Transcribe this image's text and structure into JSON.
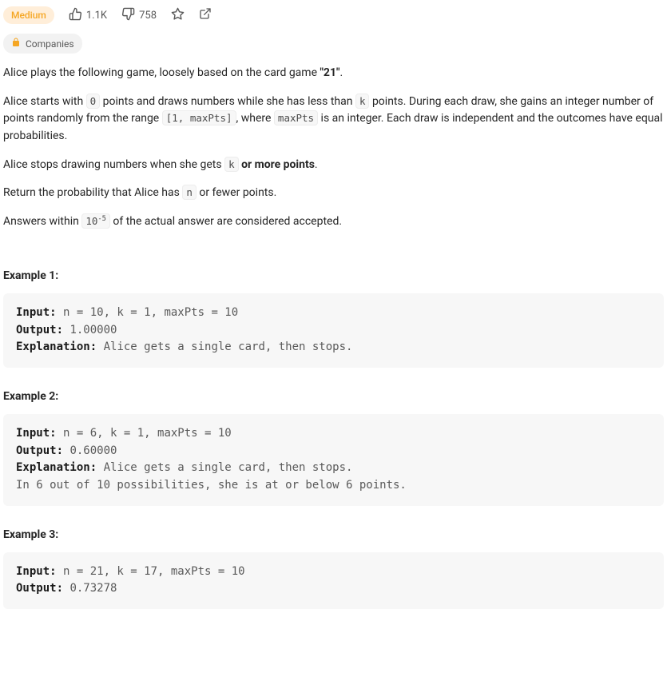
{
  "header": {
    "difficulty": "Medium",
    "likes": "1.1K",
    "dislikes": "758"
  },
  "companies": {
    "label": "Companies"
  },
  "desc": {
    "p1_a": "Alice plays the following game, loosely based on the card game ",
    "p1_b": "\"21\"",
    "p1_c": ".",
    "p2_a": "Alice starts with ",
    "p2_code1": "0",
    "p2_b": " points and draws numbers while she has less than ",
    "p2_code2": "k",
    "p2_c": " points. During each draw, she gains an integer number of points randomly from the range ",
    "p2_code3": "[1, maxPts]",
    "p2_d": ", where ",
    "p2_code4": "maxPts",
    "p2_e": " is an integer. Each draw is independent and the outcomes have equal probabilities.",
    "p3_a": "Alice stops drawing numbers when she gets ",
    "p3_code1": "k",
    "p3_b": " or more points",
    "p3_c": ".",
    "p4_a": "Return the probability that Alice has ",
    "p4_code1": "n",
    "p4_b": " or fewer points.",
    "p5_a": "Answers within ",
    "p5_code_base": "10",
    "p5_code_sup": "-5",
    "p5_b": " of the actual answer are considered accepted."
  },
  "examples": [
    {
      "heading": "Example 1:",
      "kw_input": "Input:",
      "input": " n = 10, k = 1, maxPts = 10",
      "kw_output": "Output:",
      "output": " 1.00000",
      "kw_expl": "Explanation:",
      "expl": " Alice gets a single card, then stops."
    },
    {
      "heading": "Example 2:",
      "kw_input": "Input:",
      "input": " n = 6, k = 1, maxPts = 10",
      "kw_output": "Output:",
      "output": " 0.60000",
      "kw_expl": "Explanation:",
      "expl": " Alice gets a single card, then stops.\nIn 6 out of 10 possibilities, she is at or below 6 points."
    },
    {
      "heading": "Example 3:",
      "kw_input": "Input:",
      "input": " n = 21, k = 17, maxPts = 10",
      "kw_output": "Output:",
      "output": " 0.73278"
    }
  ]
}
